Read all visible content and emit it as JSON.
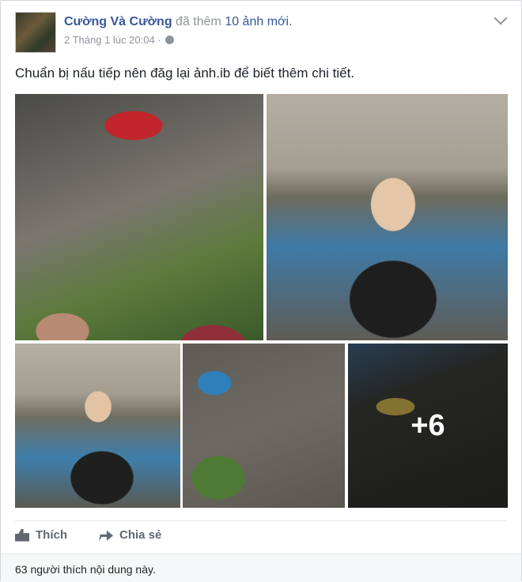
{
  "post": {
    "author": "Cường Và Cường",
    "action": "đã thêm",
    "photo_count": "10 ảnh mới.",
    "timestamp": "2 Tháng 1 lúc 20:04",
    "separator": "·",
    "privacy_icon": "globe-icon",
    "menu_icon": "chevron-down-icon",
    "text": "Chuẩn bị nấu tiếp nên đăg lại ảnh.ib để biết thêm chi tiết.",
    "more_photos": "+6"
  },
  "actions": {
    "like_label": "Thích",
    "like_icon": "thumbs-up-icon",
    "share_label": "Chia sẻ",
    "share_icon": "share-arrow-icon"
  },
  "footer": {
    "likes_text": "63 người thích nội dung này."
  },
  "colors": {
    "link": "#365899",
    "meta": "#90949c",
    "text": "#1d2129",
    "action_text": "#606770"
  }
}
